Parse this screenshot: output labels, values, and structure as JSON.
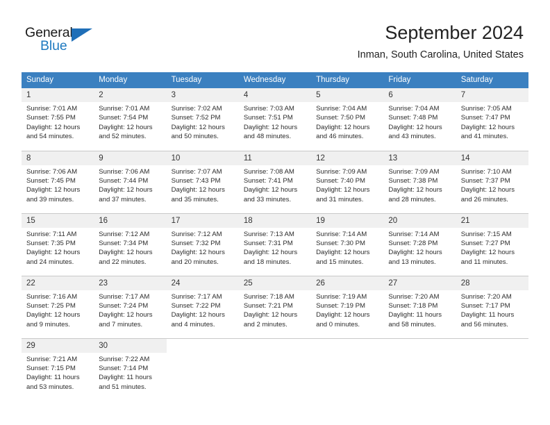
{
  "brand": {
    "name_part1": "General",
    "name_part2": "Blue",
    "triangle_icon": "triangle-icon",
    "color_black": "#1a1a1a",
    "color_blue": "#1f7ac0"
  },
  "header": {
    "month_title": "September 2024",
    "location": "Inman, South Carolina, United States"
  },
  "colors": {
    "header_blue": "#3b80c0",
    "daynum_bg": "#f0f0f0",
    "grid_line": "#c9c9c9",
    "text": "#2b2b2b"
  },
  "weekdays": [
    "Sunday",
    "Monday",
    "Tuesday",
    "Wednesday",
    "Thursday",
    "Friday",
    "Saturday"
  ],
  "weeks": [
    [
      {
        "day": "1",
        "sunrise": "Sunrise: 7:01 AM",
        "sunset": "Sunset: 7:55 PM",
        "daylight1": "Daylight: 12 hours",
        "daylight2": "and 54 minutes."
      },
      {
        "day": "2",
        "sunrise": "Sunrise: 7:01 AM",
        "sunset": "Sunset: 7:54 PM",
        "daylight1": "Daylight: 12 hours",
        "daylight2": "and 52 minutes."
      },
      {
        "day": "3",
        "sunrise": "Sunrise: 7:02 AM",
        "sunset": "Sunset: 7:52 PM",
        "daylight1": "Daylight: 12 hours",
        "daylight2": "and 50 minutes."
      },
      {
        "day": "4",
        "sunrise": "Sunrise: 7:03 AM",
        "sunset": "Sunset: 7:51 PM",
        "daylight1": "Daylight: 12 hours",
        "daylight2": "and 48 minutes."
      },
      {
        "day": "5",
        "sunrise": "Sunrise: 7:04 AM",
        "sunset": "Sunset: 7:50 PM",
        "daylight1": "Daylight: 12 hours",
        "daylight2": "and 46 minutes."
      },
      {
        "day": "6",
        "sunrise": "Sunrise: 7:04 AM",
        "sunset": "Sunset: 7:48 PM",
        "daylight1": "Daylight: 12 hours",
        "daylight2": "and 43 minutes."
      },
      {
        "day": "7",
        "sunrise": "Sunrise: 7:05 AM",
        "sunset": "Sunset: 7:47 PM",
        "daylight1": "Daylight: 12 hours",
        "daylight2": "and 41 minutes."
      }
    ],
    [
      {
        "day": "8",
        "sunrise": "Sunrise: 7:06 AM",
        "sunset": "Sunset: 7:45 PM",
        "daylight1": "Daylight: 12 hours",
        "daylight2": "and 39 minutes."
      },
      {
        "day": "9",
        "sunrise": "Sunrise: 7:06 AM",
        "sunset": "Sunset: 7:44 PM",
        "daylight1": "Daylight: 12 hours",
        "daylight2": "and 37 minutes."
      },
      {
        "day": "10",
        "sunrise": "Sunrise: 7:07 AM",
        "sunset": "Sunset: 7:43 PM",
        "daylight1": "Daylight: 12 hours",
        "daylight2": "and 35 minutes."
      },
      {
        "day": "11",
        "sunrise": "Sunrise: 7:08 AM",
        "sunset": "Sunset: 7:41 PM",
        "daylight1": "Daylight: 12 hours",
        "daylight2": "and 33 minutes."
      },
      {
        "day": "12",
        "sunrise": "Sunrise: 7:09 AM",
        "sunset": "Sunset: 7:40 PM",
        "daylight1": "Daylight: 12 hours",
        "daylight2": "and 31 minutes."
      },
      {
        "day": "13",
        "sunrise": "Sunrise: 7:09 AM",
        "sunset": "Sunset: 7:38 PM",
        "daylight1": "Daylight: 12 hours",
        "daylight2": "and 28 minutes."
      },
      {
        "day": "14",
        "sunrise": "Sunrise: 7:10 AM",
        "sunset": "Sunset: 7:37 PM",
        "daylight1": "Daylight: 12 hours",
        "daylight2": "and 26 minutes."
      }
    ],
    [
      {
        "day": "15",
        "sunrise": "Sunrise: 7:11 AM",
        "sunset": "Sunset: 7:35 PM",
        "daylight1": "Daylight: 12 hours",
        "daylight2": "and 24 minutes."
      },
      {
        "day": "16",
        "sunrise": "Sunrise: 7:12 AM",
        "sunset": "Sunset: 7:34 PM",
        "daylight1": "Daylight: 12 hours",
        "daylight2": "and 22 minutes."
      },
      {
        "day": "17",
        "sunrise": "Sunrise: 7:12 AM",
        "sunset": "Sunset: 7:32 PM",
        "daylight1": "Daylight: 12 hours",
        "daylight2": "and 20 minutes."
      },
      {
        "day": "18",
        "sunrise": "Sunrise: 7:13 AM",
        "sunset": "Sunset: 7:31 PM",
        "daylight1": "Daylight: 12 hours",
        "daylight2": "and 18 minutes."
      },
      {
        "day": "19",
        "sunrise": "Sunrise: 7:14 AM",
        "sunset": "Sunset: 7:30 PM",
        "daylight1": "Daylight: 12 hours",
        "daylight2": "and 15 minutes."
      },
      {
        "day": "20",
        "sunrise": "Sunrise: 7:14 AM",
        "sunset": "Sunset: 7:28 PM",
        "daylight1": "Daylight: 12 hours",
        "daylight2": "and 13 minutes."
      },
      {
        "day": "21",
        "sunrise": "Sunrise: 7:15 AM",
        "sunset": "Sunset: 7:27 PM",
        "daylight1": "Daylight: 12 hours",
        "daylight2": "and 11 minutes."
      }
    ],
    [
      {
        "day": "22",
        "sunrise": "Sunrise: 7:16 AM",
        "sunset": "Sunset: 7:25 PM",
        "daylight1": "Daylight: 12 hours",
        "daylight2": "and 9 minutes."
      },
      {
        "day": "23",
        "sunrise": "Sunrise: 7:17 AM",
        "sunset": "Sunset: 7:24 PM",
        "daylight1": "Daylight: 12 hours",
        "daylight2": "and 7 minutes."
      },
      {
        "day": "24",
        "sunrise": "Sunrise: 7:17 AM",
        "sunset": "Sunset: 7:22 PM",
        "daylight1": "Daylight: 12 hours",
        "daylight2": "and 4 minutes."
      },
      {
        "day": "25",
        "sunrise": "Sunrise: 7:18 AM",
        "sunset": "Sunset: 7:21 PM",
        "daylight1": "Daylight: 12 hours",
        "daylight2": "and 2 minutes."
      },
      {
        "day": "26",
        "sunrise": "Sunrise: 7:19 AM",
        "sunset": "Sunset: 7:19 PM",
        "daylight1": "Daylight: 12 hours",
        "daylight2": "and 0 minutes."
      },
      {
        "day": "27",
        "sunrise": "Sunrise: 7:20 AM",
        "sunset": "Sunset: 7:18 PM",
        "daylight1": "Daylight: 11 hours",
        "daylight2": "and 58 minutes."
      },
      {
        "day": "28",
        "sunrise": "Sunrise: 7:20 AM",
        "sunset": "Sunset: 7:17 PM",
        "daylight1": "Daylight: 11 hours",
        "daylight2": "and 56 minutes."
      }
    ],
    [
      {
        "day": "29",
        "sunrise": "Sunrise: 7:21 AM",
        "sunset": "Sunset: 7:15 PM",
        "daylight1": "Daylight: 11 hours",
        "daylight2": "and 53 minutes."
      },
      {
        "day": "30",
        "sunrise": "Sunrise: 7:22 AM",
        "sunset": "Sunset: 7:14 PM",
        "daylight1": "Daylight: 11 hours",
        "daylight2": "and 51 minutes."
      },
      {
        "day": "",
        "sunrise": "",
        "sunset": "",
        "daylight1": "",
        "daylight2": ""
      },
      {
        "day": "",
        "sunrise": "",
        "sunset": "",
        "daylight1": "",
        "daylight2": ""
      },
      {
        "day": "",
        "sunrise": "",
        "sunset": "",
        "daylight1": "",
        "daylight2": ""
      },
      {
        "day": "",
        "sunrise": "",
        "sunset": "",
        "daylight1": "",
        "daylight2": ""
      },
      {
        "day": "",
        "sunrise": "",
        "sunset": "",
        "daylight1": "",
        "daylight2": ""
      }
    ]
  ]
}
